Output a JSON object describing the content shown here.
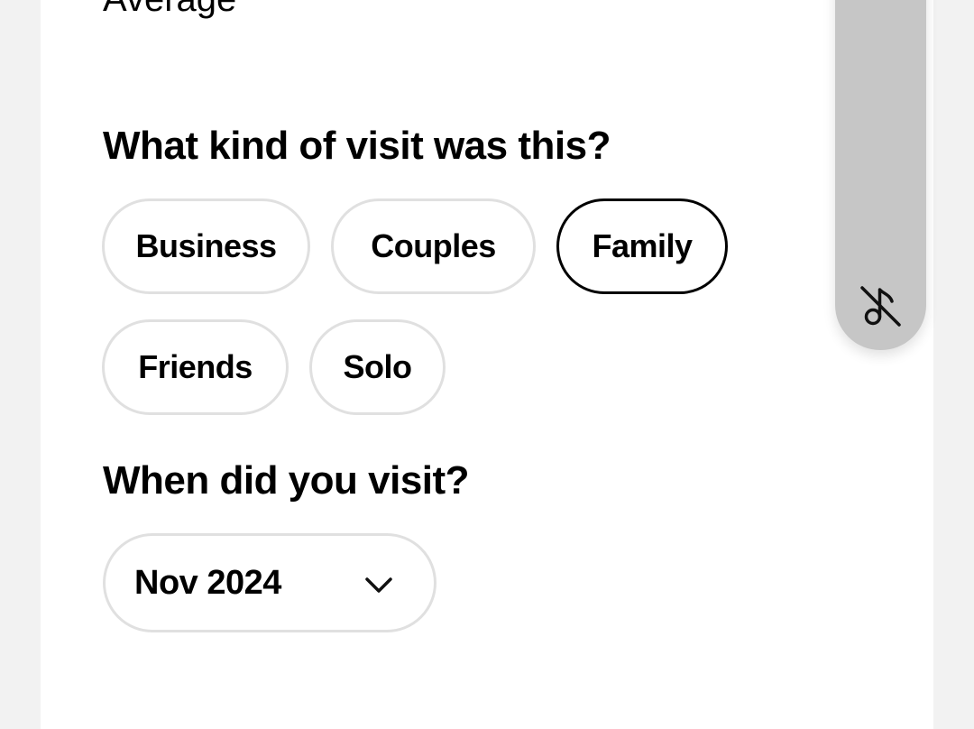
{
  "rating": {
    "label": "Average"
  },
  "visit_type": {
    "heading": "What kind of visit was this?",
    "options": [
      "Business",
      "Couples",
      "Family",
      "Friends",
      "Solo"
    ],
    "selected": "Family"
  },
  "visit_date": {
    "heading": "When did you visit?",
    "selected_value": "Nov 2024"
  },
  "media_panel": {
    "icon": "music-off-icon"
  }
}
